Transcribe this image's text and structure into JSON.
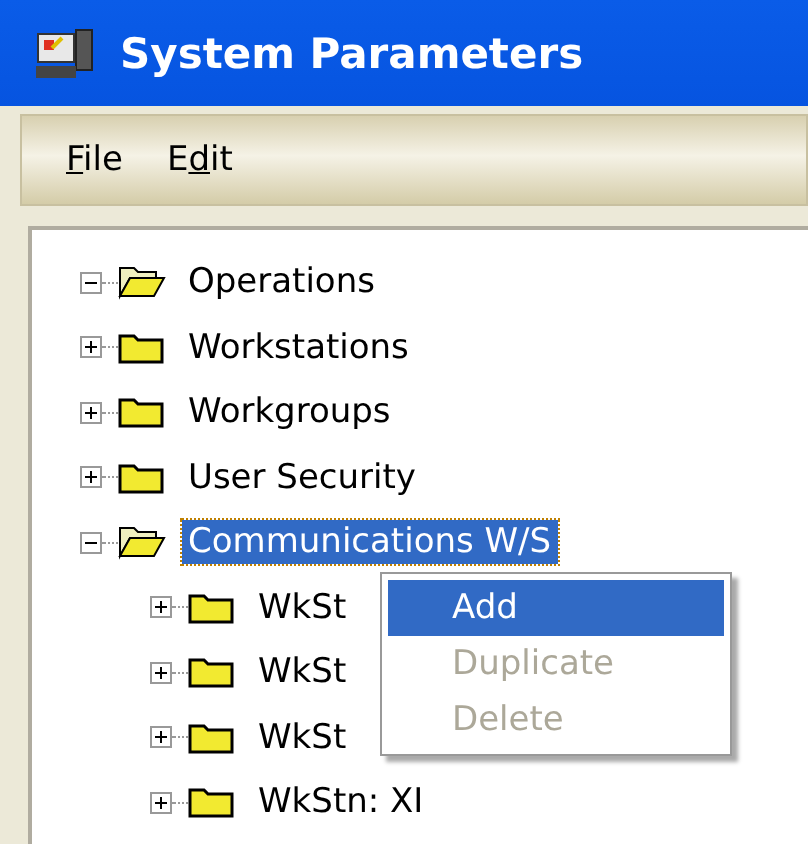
{
  "window": {
    "title": "System Parameters"
  },
  "menu_bar": [
    {
      "mnemonic": "F",
      "rest": "ile"
    },
    {
      "before": "E",
      "mnemonic": "d",
      "rest": "it"
    }
  ],
  "tree": [
    {
      "label": "Operations",
      "expanded": true,
      "selected": false
    },
    {
      "label": "Workstations",
      "expanded": false,
      "selected": false
    },
    {
      "label": "Workgroups",
      "expanded": false,
      "selected": false
    },
    {
      "label": "User Security",
      "expanded": false,
      "selected": false
    },
    {
      "label": "Communications W/S",
      "expanded": true,
      "selected": true,
      "children": [
        {
          "label": "WkSt",
          "expanded": false,
          "selected": false
        },
        {
          "label": "WkSt",
          "expanded": false,
          "selected": false
        },
        {
          "label": "WkSt",
          "expanded": false,
          "selected": false
        },
        {
          "label": "WkStn: XI",
          "expanded": false,
          "selected": false
        }
      ]
    }
  ],
  "context_menu": [
    {
      "label": "Add",
      "selected": true,
      "disabled": false
    },
    {
      "label": "Duplicate",
      "selected": false,
      "disabled": true
    },
    {
      "label": "Delete",
      "selected": false,
      "disabled": true
    }
  ]
}
